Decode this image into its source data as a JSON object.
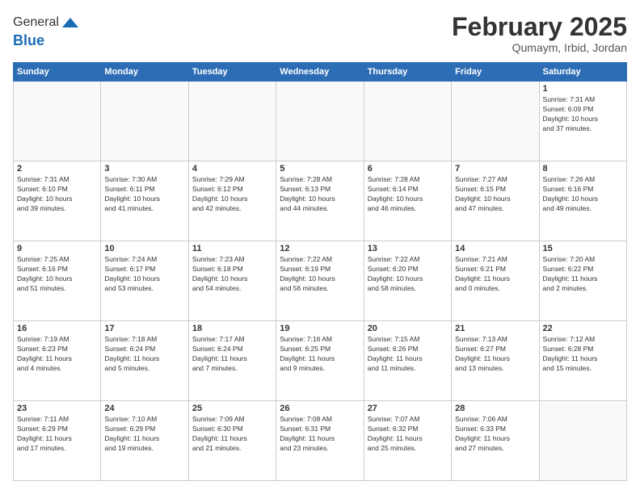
{
  "header": {
    "logo": {
      "line1": "General",
      "line2": "Blue"
    },
    "title": "February 2025",
    "location": "Qumaym, Irbid, Jordan"
  },
  "weekdays": [
    "Sunday",
    "Monday",
    "Tuesday",
    "Wednesday",
    "Thursday",
    "Friday",
    "Saturday"
  ],
  "weeks": [
    [
      {
        "day": "",
        "info": ""
      },
      {
        "day": "",
        "info": ""
      },
      {
        "day": "",
        "info": ""
      },
      {
        "day": "",
        "info": ""
      },
      {
        "day": "",
        "info": ""
      },
      {
        "day": "",
        "info": ""
      },
      {
        "day": "1",
        "info": "Sunrise: 7:31 AM\nSunset: 6:09 PM\nDaylight: 10 hours\nand 37 minutes."
      }
    ],
    [
      {
        "day": "2",
        "info": "Sunrise: 7:31 AM\nSunset: 6:10 PM\nDaylight: 10 hours\nand 39 minutes."
      },
      {
        "day": "3",
        "info": "Sunrise: 7:30 AM\nSunset: 6:11 PM\nDaylight: 10 hours\nand 41 minutes."
      },
      {
        "day": "4",
        "info": "Sunrise: 7:29 AM\nSunset: 6:12 PM\nDaylight: 10 hours\nand 42 minutes."
      },
      {
        "day": "5",
        "info": "Sunrise: 7:28 AM\nSunset: 6:13 PM\nDaylight: 10 hours\nand 44 minutes."
      },
      {
        "day": "6",
        "info": "Sunrise: 7:28 AM\nSunset: 6:14 PM\nDaylight: 10 hours\nand 46 minutes."
      },
      {
        "day": "7",
        "info": "Sunrise: 7:27 AM\nSunset: 6:15 PM\nDaylight: 10 hours\nand 47 minutes."
      },
      {
        "day": "8",
        "info": "Sunrise: 7:26 AM\nSunset: 6:16 PM\nDaylight: 10 hours\nand 49 minutes."
      }
    ],
    [
      {
        "day": "9",
        "info": "Sunrise: 7:25 AM\nSunset: 6:16 PM\nDaylight: 10 hours\nand 51 minutes."
      },
      {
        "day": "10",
        "info": "Sunrise: 7:24 AM\nSunset: 6:17 PM\nDaylight: 10 hours\nand 53 minutes."
      },
      {
        "day": "11",
        "info": "Sunrise: 7:23 AM\nSunset: 6:18 PM\nDaylight: 10 hours\nand 54 minutes."
      },
      {
        "day": "12",
        "info": "Sunrise: 7:22 AM\nSunset: 6:19 PM\nDaylight: 10 hours\nand 56 minutes."
      },
      {
        "day": "13",
        "info": "Sunrise: 7:22 AM\nSunset: 6:20 PM\nDaylight: 10 hours\nand 58 minutes."
      },
      {
        "day": "14",
        "info": "Sunrise: 7:21 AM\nSunset: 6:21 PM\nDaylight: 11 hours\nand 0 minutes."
      },
      {
        "day": "15",
        "info": "Sunrise: 7:20 AM\nSunset: 6:22 PM\nDaylight: 11 hours\nand 2 minutes."
      }
    ],
    [
      {
        "day": "16",
        "info": "Sunrise: 7:19 AM\nSunset: 6:23 PM\nDaylight: 11 hours\nand 4 minutes."
      },
      {
        "day": "17",
        "info": "Sunrise: 7:18 AM\nSunset: 6:24 PM\nDaylight: 11 hours\nand 5 minutes."
      },
      {
        "day": "18",
        "info": "Sunrise: 7:17 AM\nSunset: 6:24 PM\nDaylight: 11 hours\nand 7 minutes."
      },
      {
        "day": "19",
        "info": "Sunrise: 7:16 AM\nSunset: 6:25 PM\nDaylight: 11 hours\nand 9 minutes."
      },
      {
        "day": "20",
        "info": "Sunrise: 7:15 AM\nSunset: 6:26 PM\nDaylight: 11 hours\nand 11 minutes."
      },
      {
        "day": "21",
        "info": "Sunrise: 7:13 AM\nSunset: 6:27 PM\nDaylight: 11 hours\nand 13 minutes."
      },
      {
        "day": "22",
        "info": "Sunrise: 7:12 AM\nSunset: 6:28 PM\nDaylight: 11 hours\nand 15 minutes."
      }
    ],
    [
      {
        "day": "23",
        "info": "Sunrise: 7:11 AM\nSunset: 6:29 PM\nDaylight: 11 hours\nand 17 minutes."
      },
      {
        "day": "24",
        "info": "Sunrise: 7:10 AM\nSunset: 6:29 PM\nDaylight: 11 hours\nand 19 minutes."
      },
      {
        "day": "25",
        "info": "Sunrise: 7:09 AM\nSunset: 6:30 PM\nDaylight: 11 hours\nand 21 minutes."
      },
      {
        "day": "26",
        "info": "Sunrise: 7:08 AM\nSunset: 6:31 PM\nDaylight: 11 hours\nand 23 minutes."
      },
      {
        "day": "27",
        "info": "Sunrise: 7:07 AM\nSunset: 6:32 PM\nDaylight: 11 hours\nand 25 minutes."
      },
      {
        "day": "28",
        "info": "Sunrise: 7:06 AM\nSunset: 6:33 PM\nDaylight: 11 hours\nand 27 minutes."
      },
      {
        "day": "",
        "info": ""
      }
    ]
  ]
}
